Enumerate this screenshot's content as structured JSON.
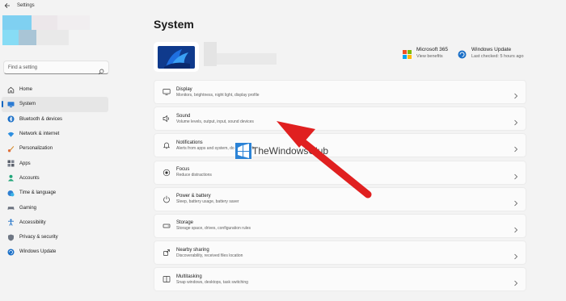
{
  "window": {
    "title": "Settings"
  },
  "sidebar": {
    "search_placeholder": "Find a setting",
    "items": [
      {
        "label": "Home",
        "icon": "home-icon",
        "active": false
      },
      {
        "label": "System",
        "icon": "monitor-icon",
        "active": true
      },
      {
        "label": "Bluetooth & devices",
        "icon": "bluetooth-icon",
        "active": false
      },
      {
        "label": "Network & internet",
        "icon": "wifi-icon",
        "active": false
      },
      {
        "label": "Personalization",
        "icon": "brush-icon",
        "active": false
      },
      {
        "label": "Apps",
        "icon": "apps-icon",
        "active": false
      },
      {
        "label": "Accounts",
        "icon": "person-icon",
        "active": false
      },
      {
        "label": "Time & language",
        "icon": "globe-clock-icon",
        "active": false
      },
      {
        "label": "Gaming",
        "icon": "gamepad-icon",
        "active": false
      },
      {
        "label": "Accessibility",
        "icon": "accessibility-icon",
        "active": false
      },
      {
        "label": "Privacy & security",
        "icon": "shield-icon",
        "active": false
      },
      {
        "label": "Windows Update",
        "icon": "update-icon",
        "active": false
      }
    ]
  },
  "main": {
    "title": "System",
    "quick_links": [
      {
        "title": "Microsoft 365",
        "subtitle": "View benefits",
        "icon": "microsoft-logo-icon"
      },
      {
        "title": "Windows Update",
        "subtitle": "Last checked: 5 hours ago",
        "icon": "update-icon"
      }
    ],
    "cards": [
      {
        "title": "Display",
        "subtitle": "Monitors, brightness, night light, display profile",
        "icon": "display-icon"
      },
      {
        "title": "Sound",
        "subtitle": "Volume levels, output, input, sound devices",
        "icon": "speaker-icon"
      },
      {
        "title": "Notifications",
        "subtitle": "Alerts from apps and system, do not disturb",
        "icon": "bell-icon"
      },
      {
        "title": "Focus",
        "subtitle": "Reduce distractions",
        "icon": "focus-icon"
      },
      {
        "title": "Power & battery",
        "subtitle": "Sleep, battery usage, battery saver",
        "icon": "power-icon"
      },
      {
        "title": "Storage",
        "subtitle": "Storage space, drives, configuration rules",
        "icon": "storage-icon"
      },
      {
        "title": "Nearby sharing",
        "subtitle": "Discoverability, received files location",
        "icon": "share-icon"
      },
      {
        "title": "Multitasking",
        "subtitle": "Snap windows, desktops, task switching",
        "icon": "multitasking-icon"
      }
    ]
  },
  "watermark": {
    "text": "TheWindowsClub"
  },
  "colors": {
    "accent": "#1066c0",
    "arrow": "#e02020",
    "background": "#f3f3f3",
    "card": "#fbfbfb"
  }
}
